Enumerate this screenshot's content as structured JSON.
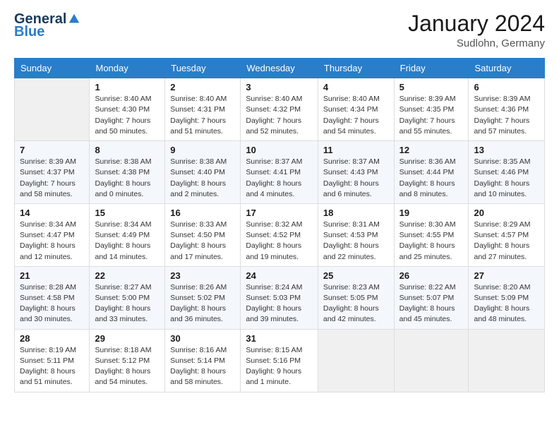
{
  "header": {
    "logo_general": "General",
    "logo_blue": "Blue",
    "month_title": "January 2024",
    "location": "Sudlohn, Germany"
  },
  "weekdays": [
    "Sunday",
    "Monday",
    "Tuesday",
    "Wednesday",
    "Thursday",
    "Friday",
    "Saturday"
  ],
  "weeks": [
    [
      {
        "day": "",
        "info": ""
      },
      {
        "day": "1",
        "info": "Sunrise: 8:40 AM\nSunset: 4:30 PM\nDaylight: 7 hours\nand 50 minutes."
      },
      {
        "day": "2",
        "info": "Sunrise: 8:40 AM\nSunset: 4:31 PM\nDaylight: 7 hours\nand 51 minutes."
      },
      {
        "day": "3",
        "info": "Sunrise: 8:40 AM\nSunset: 4:32 PM\nDaylight: 7 hours\nand 52 minutes."
      },
      {
        "day": "4",
        "info": "Sunrise: 8:40 AM\nSunset: 4:34 PM\nDaylight: 7 hours\nand 54 minutes."
      },
      {
        "day": "5",
        "info": "Sunrise: 8:39 AM\nSunset: 4:35 PM\nDaylight: 7 hours\nand 55 minutes."
      },
      {
        "day": "6",
        "info": "Sunrise: 8:39 AM\nSunset: 4:36 PM\nDaylight: 7 hours\nand 57 minutes."
      }
    ],
    [
      {
        "day": "7",
        "info": "Sunrise: 8:39 AM\nSunset: 4:37 PM\nDaylight: 7 hours\nand 58 minutes."
      },
      {
        "day": "8",
        "info": "Sunrise: 8:38 AM\nSunset: 4:38 PM\nDaylight: 8 hours\nand 0 minutes."
      },
      {
        "day": "9",
        "info": "Sunrise: 8:38 AM\nSunset: 4:40 PM\nDaylight: 8 hours\nand 2 minutes."
      },
      {
        "day": "10",
        "info": "Sunrise: 8:37 AM\nSunset: 4:41 PM\nDaylight: 8 hours\nand 4 minutes."
      },
      {
        "day": "11",
        "info": "Sunrise: 8:37 AM\nSunset: 4:43 PM\nDaylight: 8 hours\nand 6 minutes."
      },
      {
        "day": "12",
        "info": "Sunrise: 8:36 AM\nSunset: 4:44 PM\nDaylight: 8 hours\nand 8 minutes."
      },
      {
        "day": "13",
        "info": "Sunrise: 8:35 AM\nSunset: 4:46 PM\nDaylight: 8 hours\nand 10 minutes."
      }
    ],
    [
      {
        "day": "14",
        "info": "Sunrise: 8:34 AM\nSunset: 4:47 PM\nDaylight: 8 hours\nand 12 minutes."
      },
      {
        "day": "15",
        "info": "Sunrise: 8:34 AM\nSunset: 4:49 PM\nDaylight: 8 hours\nand 14 minutes."
      },
      {
        "day": "16",
        "info": "Sunrise: 8:33 AM\nSunset: 4:50 PM\nDaylight: 8 hours\nand 17 minutes."
      },
      {
        "day": "17",
        "info": "Sunrise: 8:32 AM\nSunset: 4:52 PM\nDaylight: 8 hours\nand 19 minutes."
      },
      {
        "day": "18",
        "info": "Sunrise: 8:31 AM\nSunset: 4:53 PM\nDaylight: 8 hours\nand 22 minutes."
      },
      {
        "day": "19",
        "info": "Sunrise: 8:30 AM\nSunset: 4:55 PM\nDaylight: 8 hours\nand 25 minutes."
      },
      {
        "day": "20",
        "info": "Sunrise: 8:29 AM\nSunset: 4:57 PM\nDaylight: 8 hours\nand 27 minutes."
      }
    ],
    [
      {
        "day": "21",
        "info": "Sunrise: 8:28 AM\nSunset: 4:58 PM\nDaylight: 8 hours\nand 30 minutes."
      },
      {
        "day": "22",
        "info": "Sunrise: 8:27 AM\nSunset: 5:00 PM\nDaylight: 8 hours\nand 33 minutes."
      },
      {
        "day": "23",
        "info": "Sunrise: 8:26 AM\nSunset: 5:02 PM\nDaylight: 8 hours\nand 36 minutes."
      },
      {
        "day": "24",
        "info": "Sunrise: 8:24 AM\nSunset: 5:03 PM\nDaylight: 8 hours\nand 39 minutes."
      },
      {
        "day": "25",
        "info": "Sunrise: 8:23 AM\nSunset: 5:05 PM\nDaylight: 8 hours\nand 42 minutes."
      },
      {
        "day": "26",
        "info": "Sunrise: 8:22 AM\nSunset: 5:07 PM\nDaylight: 8 hours\nand 45 minutes."
      },
      {
        "day": "27",
        "info": "Sunrise: 8:20 AM\nSunset: 5:09 PM\nDaylight: 8 hours\nand 48 minutes."
      }
    ],
    [
      {
        "day": "28",
        "info": "Sunrise: 8:19 AM\nSunset: 5:11 PM\nDaylight: 8 hours\nand 51 minutes."
      },
      {
        "day": "29",
        "info": "Sunrise: 8:18 AM\nSunset: 5:12 PM\nDaylight: 8 hours\nand 54 minutes."
      },
      {
        "day": "30",
        "info": "Sunrise: 8:16 AM\nSunset: 5:14 PM\nDaylight: 8 hours\nand 58 minutes."
      },
      {
        "day": "31",
        "info": "Sunrise: 8:15 AM\nSunset: 5:16 PM\nDaylight: 9 hours\nand 1 minute."
      },
      {
        "day": "",
        "info": ""
      },
      {
        "day": "",
        "info": ""
      },
      {
        "day": "",
        "info": ""
      }
    ]
  ]
}
